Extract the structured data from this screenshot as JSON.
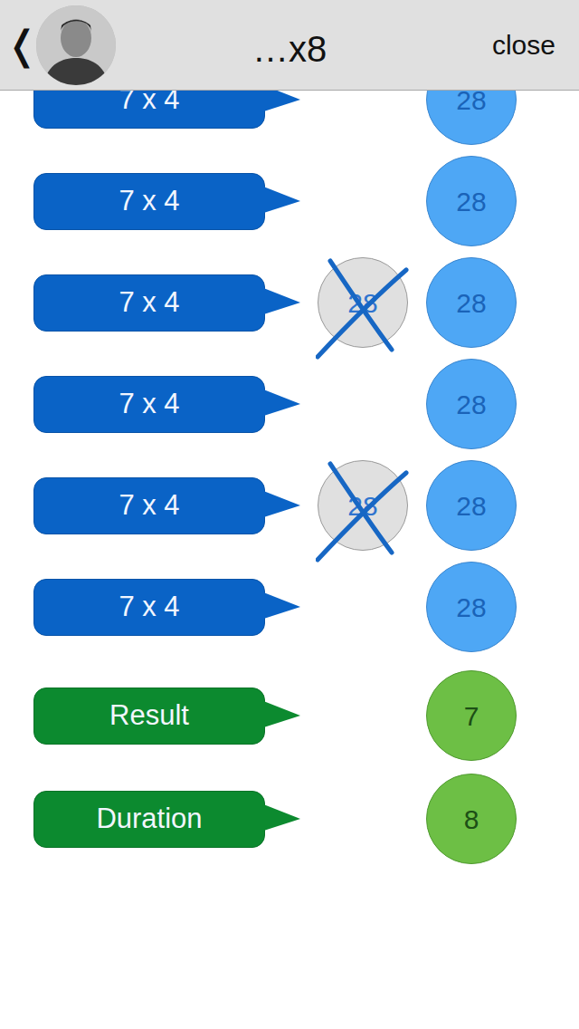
{
  "header": {
    "back": "❬",
    "title": "…x8",
    "close": "close"
  },
  "rows": [
    {
      "label": "7 x 4",
      "answer": "28",
      "wrong": null
    },
    {
      "label": "7 x 4",
      "answer": "28",
      "wrong": null
    },
    {
      "label": "7 x 4",
      "answer": "28",
      "wrong": {
        "text": "28",
        "crossed": true
      }
    },
    {
      "label": "7 x 4",
      "answer": "28",
      "wrong": null
    },
    {
      "label": "7 x 4",
      "answer": "28",
      "wrong": {
        "text": "28",
        "crossed": true
      }
    },
    {
      "label": "7 x 4",
      "answer": "28",
      "wrong": null
    }
  ],
  "summary": [
    {
      "label": "Result",
      "value": "7"
    },
    {
      "label": "Duration",
      "value": "8"
    }
  ]
}
